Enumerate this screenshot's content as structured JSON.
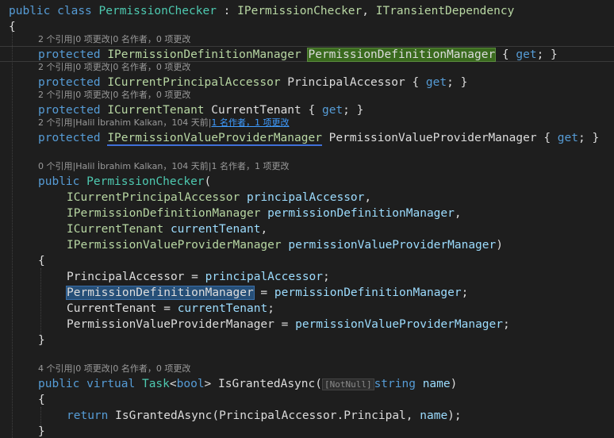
{
  "class_decl": {
    "modifier": "public",
    "keyword": "class",
    "name": "PermissionChecker",
    "sep": " : ",
    "iface1": "IPermissionChecker",
    "comma": ", ",
    "iface2": "ITransientDependency"
  },
  "open_brace": "{",
  "close_brace": "}",
  "lens": {
    "l1": "2 个引用|0 项更改|0 名作者，0 项更改",
    "l2": "2 个引用|0 项更改|0 名作者，0 项更改",
    "l3": "2 个引用|0 项更改|0 名作者，0 项更改",
    "l4_prefix": "2 个引用|Halil İbrahim Kalkan，104 天前|",
    "l4_link": "1 名作者，1 项更改",
    "l5": "0 个引用|Halil İbrahim Kalkan，104 天前|1 名作者，1 项更改",
    "l6": "4 个引用|0 项更改|0 名作者，0 项更改"
  },
  "props": [
    {
      "modifier": "protected",
      "type": "IPermissionDefinitionManager",
      "name": "PermissionDefinitionManager",
      "accessor": "{ get; }"
    },
    {
      "modifier": "protected",
      "type": "ICurrentPrincipalAccessor",
      "name": "PrincipalAccessor",
      "accessor": "{ get; }"
    },
    {
      "modifier": "protected",
      "type": "ICurrentTenant",
      "name": "CurrentTenant",
      "accessor": "{ get; }"
    },
    {
      "modifier": "protected",
      "type": "IPermissionValueProviderManager",
      "name": "PermissionValueProviderManager",
      "accessor": "{ get; }"
    }
  ],
  "ctor": {
    "modifier": "public",
    "name": "PermissionChecker",
    "paren": "(",
    "params": [
      {
        "type": "ICurrentPrincipalAccessor",
        "name": "principalAccessor",
        "sep": ","
      },
      {
        "type": "IPermissionDefinitionManager",
        "name": "permissionDefinitionManager",
        "sep": ","
      },
      {
        "type": "ICurrentTenant",
        "name": "currentTenant",
        "sep": ","
      },
      {
        "type": "IPermissionValueProviderManager",
        "name": "permissionValueProviderManager",
        "sep": ")"
      }
    ],
    "assigns": [
      {
        "left": "PrincipalAccessor",
        "right": "principalAccessor"
      },
      {
        "left": "PermissionDefinitionManager",
        "right": "permissionDefinitionManager"
      },
      {
        "left": "CurrentTenant",
        "right": "currentTenant"
      },
      {
        "left": "PermissionValueProviderManager",
        "right": "permissionValueProviderManager"
      }
    ],
    "eq": " = ",
    "semi": ";"
  },
  "method": {
    "modifier": "public",
    "virtual": "virtual",
    "ret_type": "Task",
    "ret_generic": "<bool>",
    "name": "IsGrantedAsync",
    "open": "(",
    "attr": "[NotNull]",
    "ptype": "string",
    "pname": "name",
    "close": ")",
    "body_return": "return",
    "body_call": "IsGrantedAsync",
    "body_args": "(PrincipalAccessor.Principal, ",
    "body_arg2": "name",
    "body_end": ");"
  }
}
